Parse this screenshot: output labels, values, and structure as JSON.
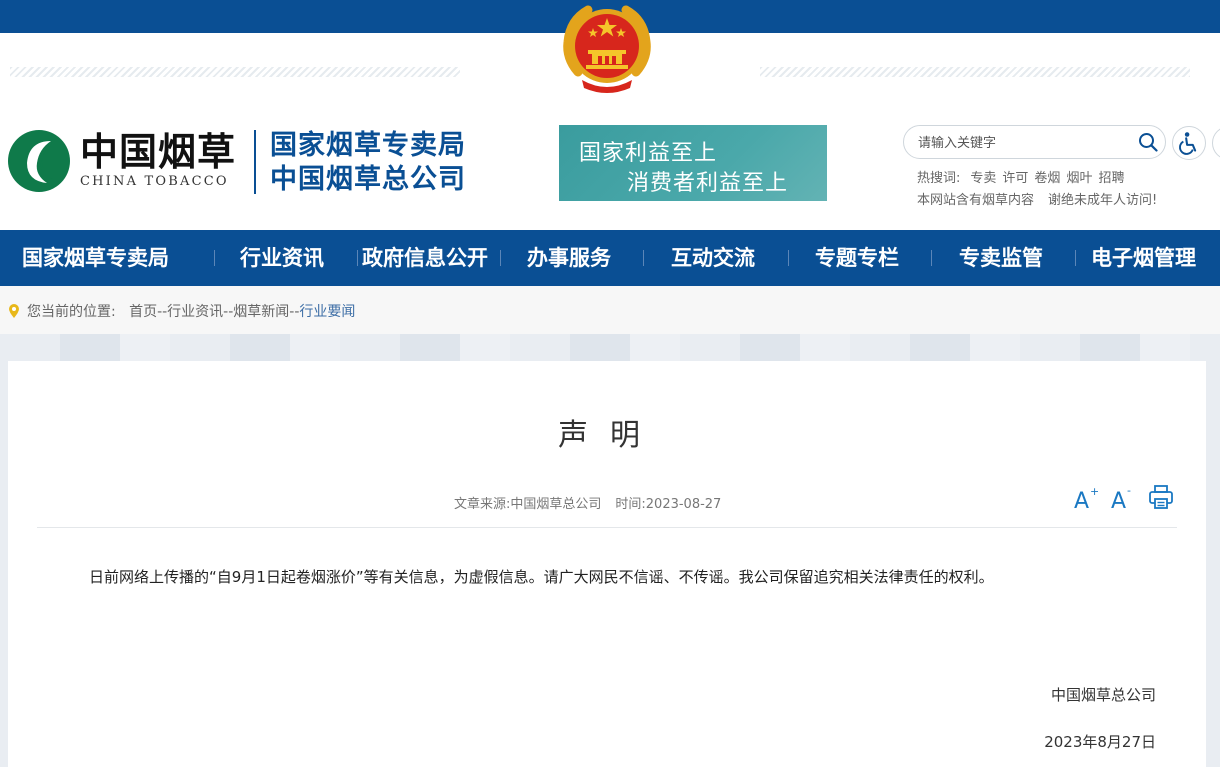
{
  "header": {
    "logo": {
      "cn": "中国烟草",
      "en": "CHINA TOBACCO"
    },
    "org_lines": [
      "国家烟草专卖局",
      "中国烟草总公司"
    ],
    "slogan": {
      "line1": "国家利益至上",
      "line2": "消费者利益至上"
    },
    "search": {
      "placeholder": "请输入关键字",
      "value": ""
    },
    "hot_label": "热搜词:",
    "hot_words": [
      "专卖",
      "许可",
      "卷烟",
      "烟叶",
      "招聘"
    ],
    "notice": [
      "本网站含有烟草内容",
      "谢绝未成年人访问!"
    ]
  },
  "nav": {
    "items": [
      "国家烟草专卖局",
      "行业资讯",
      "政府信息公开",
      "办事服务",
      "互动交流",
      "专题专栏",
      "专卖监管",
      "电子烟管理"
    ]
  },
  "breadcrumb": {
    "label": "您当前的位置:",
    "path": "首页--行业资讯--烟草新闻--",
    "current": "行业要闻"
  },
  "article": {
    "title": "声明",
    "source": "文章来源:中国烟草总公司",
    "time": "时间:2023-08-27",
    "body": "日前网络上传播的“自9月1日起卷烟涨价”等有关信息，为虚假信息。请广大网民不信谣、不传谣。我公司保留追究相关法律责任的权利。",
    "signature": "中国烟草总公司",
    "date": "2023年8月27日"
  },
  "colors": {
    "brand_blue": "#0a4f94",
    "slogan_teal": "#4aa8aa",
    "tool_blue": "#1a78c2"
  },
  "icons": {
    "search": "search-icon",
    "accessibility": "accessibility-icon",
    "location": "location-pin-icon",
    "font_up": "font-increase-icon",
    "font_down": "font-decrease-icon",
    "print": "print-icon"
  }
}
